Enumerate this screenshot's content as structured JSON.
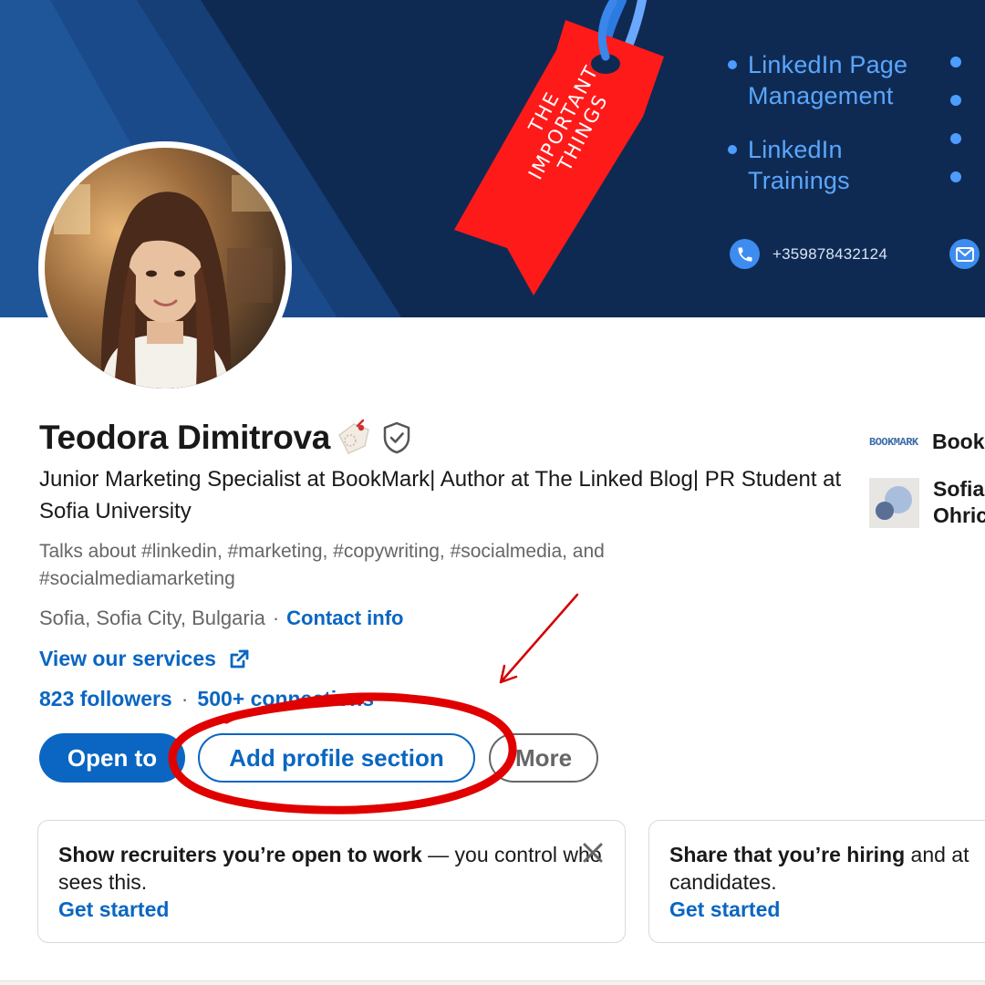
{
  "banner": {
    "list_items": [
      "LinkedIn Page Management",
      "LinkedIn Trainings"
    ],
    "tag_text": "THE IMPORTANT THINGS",
    "phone": "+359878432124",
    "icons": [
      "phone-icon",
      "mail-icon"
    ],
    "colors": {
      "background": "#0f2a52",
      "tag": "#ff1a1a",
      "accent": "#4d9cff"
    }
  },
  "profile": {
    "name": "Teodora Dimitrova",
    "headline": "Junior Marketing Specialist at BookMark| Author at The Linked Blog| PR Student at Sofia University",
    "talks_about": "Talks about #linkedin, #marketing, #copywriting, #socialmedia, and #socialmediamarketing",
    "location": "Sofia, Sofia City, Bulgaria",
    "contact_info": "Contact info",
    "services_link": "View our services",
    "followers": "823 followers",
    "connections": "500+ connections"
  },
  "actions": {
    "open_to": "Open to",
    "add_section": "Add profile section",
    "more": "More"
  },
  "experience": {
    "company_logo_text": "BOOKMARK",
    "company": "Book",
    "school_line1": "Sofia",
    "school_line2": "Ohric"
  },
  "promos": [
    {
      "strong": "Show recruiters you’re open to work",
      "rest": " — you control who sees this.",
      "cta": "Get started"
    },
    {
      "strong": "Share that you’re hiring",
      "rest": " and at candidates.",
      "cta": "Get started"
    }
  ],
  "colors": {
    "link": "#0a66c2",
    "annotation": "#e00000"
  }
}
